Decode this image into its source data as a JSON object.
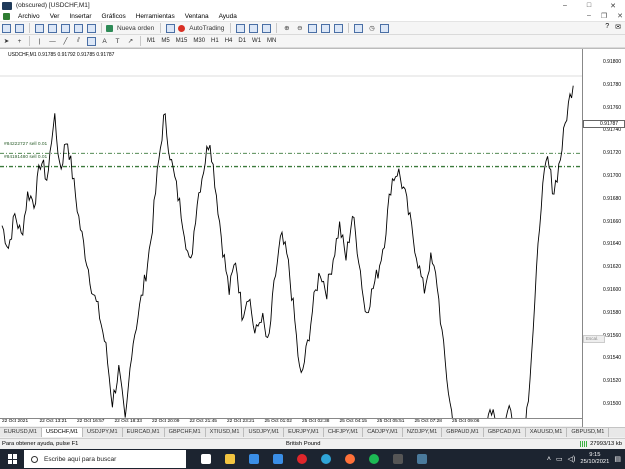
{
  "window": {
    "title": "(obscured) [USDCHF,M1]"
  },
  "menu": [
    "Archivo",
    "Ver",
    "Insertar",
    "Gráficos",
    "Herramientas",
    "Ventana",
    "Ayuda"
  ],
  "toolbar": {
    "new_order": "Nueva orden",
    "autotrading": "AutoTrading",
    "timeframes": [
      "M1",
      "M5",
      "M15",
      "M30",
      "H1",
      "H4",
      "D1",
      "W1",
      "MN"
    ]
  },
  "chart": {
    "header": "USDCHF,M1  0.91785 0.91792 0.91785 0.91787",
    "current_price": "0.91787",
    "side_tag": "Escal.",
    "order_labels": [
      "#84222727 sell 0.01",
      "#84191480 sell 0.01"
    ],
    "price_labels": [
      "0.91800",
      "0.91780",
      "0.91760",
      "0.91740",
      "0.91720",
      "0.91700",
      "0.91680",
      "0.91660",
      "0.91640",
      "0.91620",
      "0.91600",
      "0.91580",
      "0.91560",
      "0.91540",
      "0.91520",
      "0.91500"
    ],
    "time_labels": [
      "22 Oct 2021",
      "22 Oct 13:21",
      "22 Oct 16:57",
      "22 Oct 18:33",
      "22 Oct 20:09",
      "22 Oct 21:45",
      "22 Oct 23:21",
      "25 Oct 01:02",
      "25 Oct 02:38",
      "25 Oct 04:15",
      "25 Oct 05:51",
      "25 Oct 07:28",
      "25 Oct 09:06"
    ]
  },
  "chart_data": {
    "type": "line",
    "title": "USDCHF,M1",
    "ylim": [
      0.9149,
      0.9181
    ],
    "y": [
      0.9166,
      0.9164,
      0.9167,
      0.9165,
      0.9169,
      0.9168,
      0.9172,
      0.917,
      0.9176,
      0.9171,
      0.9174,
      0.917,
      0.9166,
      0.9163,
      0.916,
      0.9158,
      0.9155,
      0.915,
      0.9153,
      0.9148,
      0.9155,
      0.9158,
      0.9161,
      0.9165,
      0.9171,
      0.9176,
      0.9172,
      0.9169,
      0.9166,
      0.9162,
      0.9168,
      0.9171,
      0.9174,
      0.9169,
      0.9164,
      0.916,
      0.9163,
      0.9158,
      0.916,
      0.9156,
      0.9158,
      0.9155,
      0.9161,
      0.9165,
      0.9163,
      0.9158,
      0.9152,
      0.9155,
      0.9159,
      0.9162,
      0.916,
      0.9163,
      0.9166,
      0.9163,
      0.9167,
      0.9163,
      0.9158,
      0.916,
      0.9162,
      0.9165,
      0.917,
      0.9171,
      0.9169,
      0.9166,
      0.9163,
      0.916,
      0.9163,
      0.9161,
      0.9155,
      0.915,
      0.9147,
      0.9146,
      0.9143,
      0.9142,
      0.9145,
      0.915,
      0.9148,
      0.9147,
      0.915,
      0.9148,
      0.9146,
      0.915,
      0.9158,
      0.9168,
      0.9172,
      0.9169,
      0.9172,
      0.9176,
      0.9179
    ],
    "order_levels": [
      0.91725,
      0.91713
    ],
    "grid": false
  },
  "symbol_tabs": [
    "EURUSD,M1",
    "USDCHF,M1",
    "USDJPY,M1",
    "EURCAD,M1",
    "GBPCHF,M1",
    "XTIUSD,M1",
    "USDJPY,M1",
    "EURJPY,M1",
    "CHFJPY,M1",
    "CADJPY,M1",
    "NZDJPY,M1",
    "GBPAUD,M1",
    "GBPCAD,M1",
    "XAUUSD,M1",
    "GBPUSD,M1"
  ],
  "status": {
    "help": "Para obtener ayuda, pulse F1",
    "profile": "British Pound",
    "traffic": "27993/13 kb"
  },
  "taskbar": {
    "search_placeholder": "Escribe aquí para buscar",
    "time": "9:15",
    "date": "25/10/2021",
    "apps": [
      {
        "name": "task-view",
        "color": "#ffffff"
      },
      {
        "name": "file-explorer",
        "color": "#f2c440"
      },
      {
        "name": "store",
        "color": "#3a8ee6"
      },
      {
        "name": "mail",
        "color": "#3a8ee6"
      },
      {
        "name": "opera",
        "color": "#e0262b"
      },
      {
        "name": "edge",
        "color": "#2fa5d8"
      },
      {
        "name": "firefox",
        "color": "#ff7139"
      },
      {
        "name": "spotify",
        "color": "#1db954"
      },
      {
        "name": "terminal",
        "color": "#555555"
      },
      {
        "name": "metatrader",
        "color": "#4a7a9c"
      }
    ]
  }
}
